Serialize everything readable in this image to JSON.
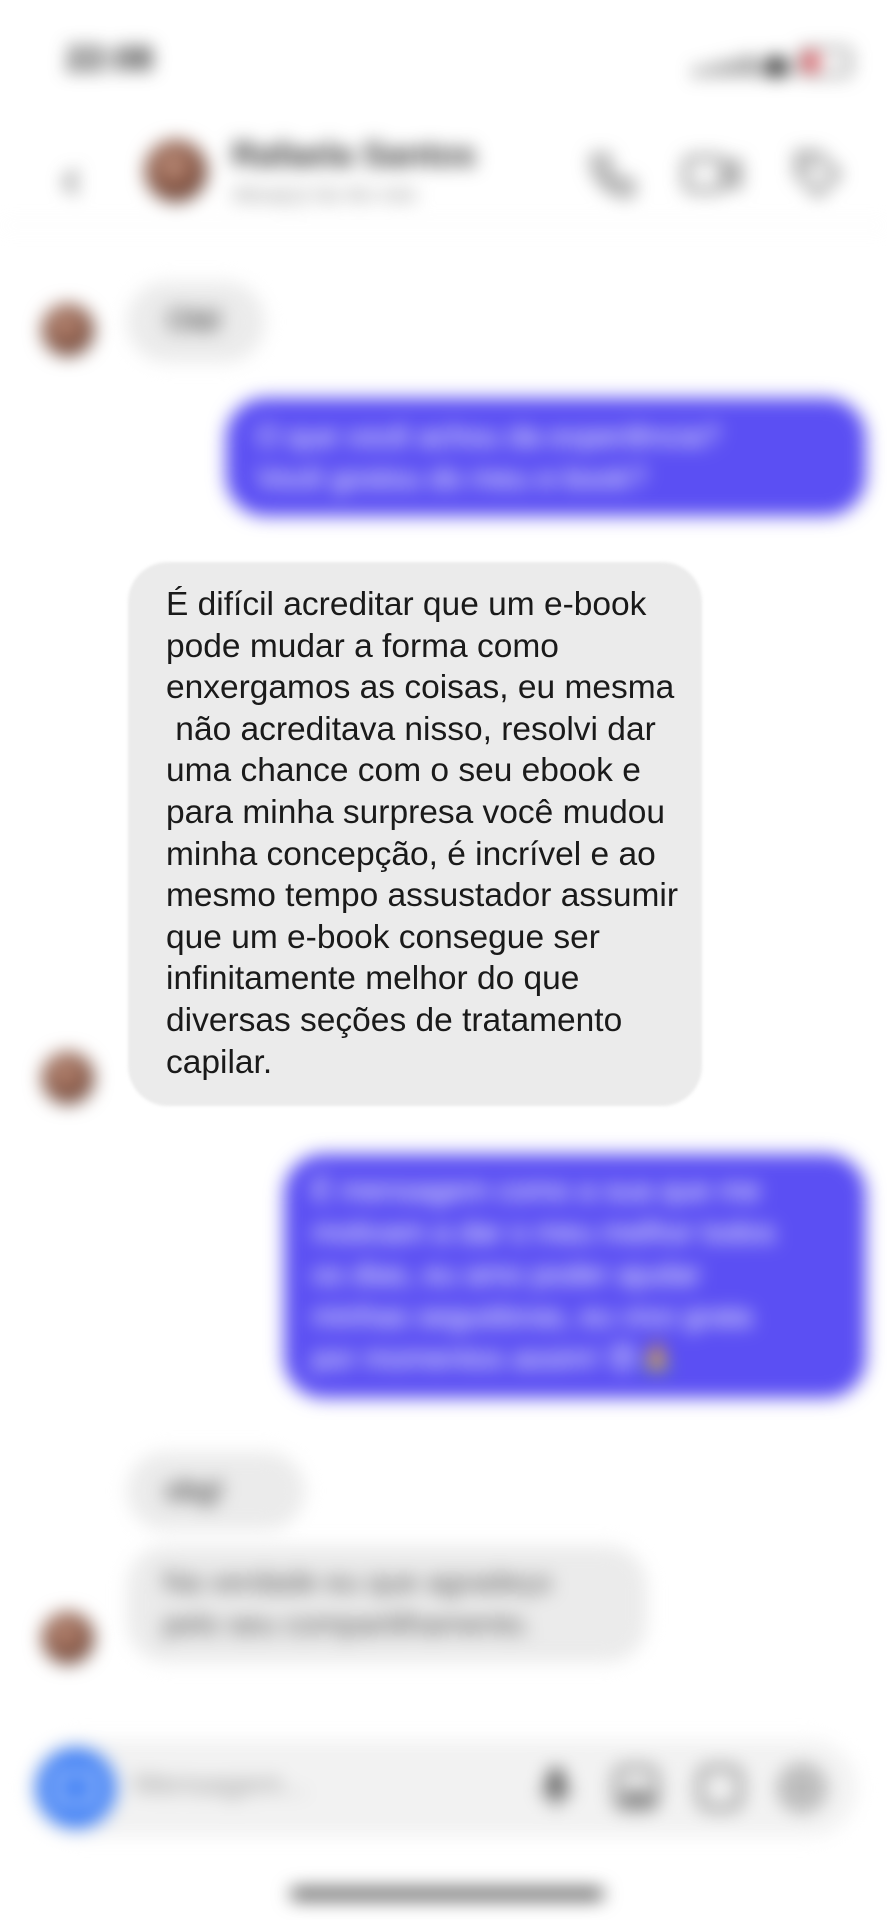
{
  "status_bar": {
    "time": "22:08"
  },
  "header": {
    "contact_name": "Rafaela Santos",
    "contact_status": "Ativa(o) há 4m min"
  },
  "messages": [
    {
      "direction": "incoming",
      "text": "Olá!"
    },
    {
      "direction": "outgoing",
      "lines": [
        "O que você achou da experiência?",
        "Você gostou do meu e-book?"
      ]
    },
    {
      "direction": "incoming",
      "lines": [
        "É difícil acreditar que um e-book",
        "pode mudar a forma como",
        "enxergamos as coisas, eu mesma",
        " não acreditava nisso, resolvi dar",
        "uma chance com o seu ebook e",
        "para minha surpresa você mudou",
        "minha concepção, é incrível e ao",
        "mesmo tempo assustador assumir",
        "que um e-book consegue ser",
        "infinitamente melhor do que",
        "diversas seções de tratamento",
        "capilar."
      ]
    },
    {
      "direction": "outgoing",
      "lines": [
        "É mensagem como a sua que me",
        "motivam a dar o meu melhor todos",
        "os dias, eu amo poder ajudar",
        "minhas seguidoras, eu vivo grata",
        "por momentos assim! 😍🙏"
      ]
    },
    {
      "direction": "incoming",
      "text": "obg!"
    },
    {
      "direction": "incoming",
      "lines": [
        "Na verdade eu que agradeço",
        "pelo seu compartilhamento."
      ]
    }
  ],
  "composer": {
    "placeholder": "Mensagem..."
  },
  "colors": {
    "outgoing_bubble": "#5b4ff3",
    "incoming_bubble": "#ebebeb",
    "camera_button": "#3d7ef5"
  },
  "icons": [
    "chevron-left-icon",
    "phone-icon",
    "video-icon",
    "tag-icon",
    "camera-icon",
    "mic-icon",
    "gallery-icon",
    "sticker-icon",
    "plus-icon"
  ]
}
